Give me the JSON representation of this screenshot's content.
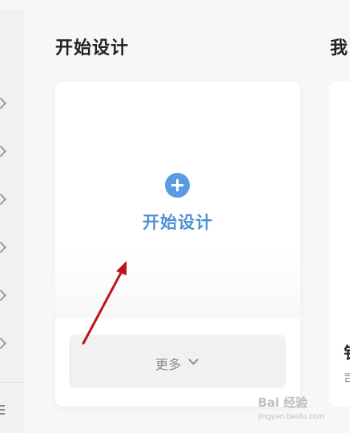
{
  "header": {
    "section_title": "开始设计",
    "next_section_title": "我"
  },
  "start_card": {
    "plus_icon": "plus-circle-icon",
    "label": "开始设计",
    "more_label": "更多"
  },
  "next_card": {
    "title": "钅",
    "subtitle": "司"
  },
  "sidebar": {
    "items": [
      "chevron-right-icon",
      "chevron-right-icon",
      "chevron-right-icon",
      "chevron-right-icon",
      "chevron-right-icon",
      "chevron-right-icon"
    ],
    "menu_icon": "menu-icon"
  },
  "watermark": {
    "text": "Bai 经验",
    "sub": "jingyan.baidu.com"
  },
  "colors": {
    "accent": "#5b9be3",
    "label_blue": "#4e8fd6",
    "arrow": "#c0141a"
  }
}
